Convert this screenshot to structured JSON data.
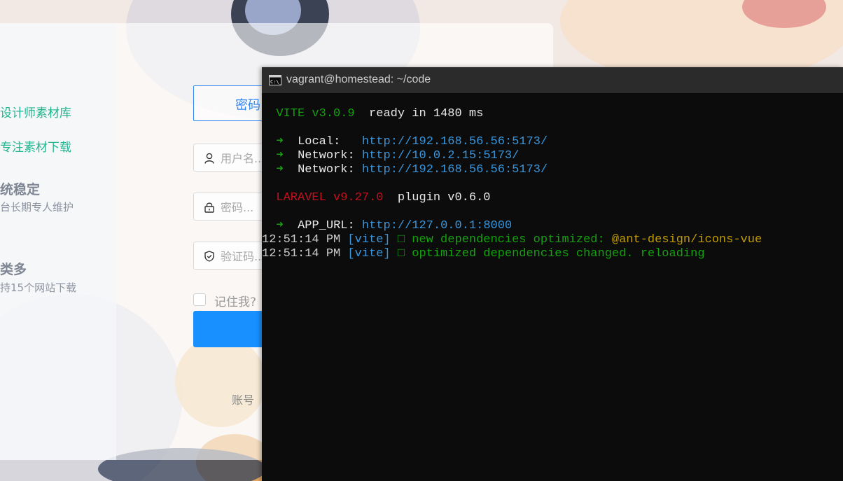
{
  "login": {
    "features": [
      {
        "text": "设计师素材库"
      },
      {
        "text": "专注素材下载"
      },
      {
        "title": "统稳定",
        "subtitle": "台长期专人维护"
      },
      {
        "title": "类多",
        "subtitle": "持15个网站下载"
      }
    ],
    "tab_label": "密码",
    "username_placeholder": "用户名...",
    "password_placeholder": "密码...",
    "captcha_placeholder": "验证码...",
    "remember_label": "记住我?",
    "account_link": "账号"
  },
  "terminal": {
    "window_title": "vagrant@homestead: ~/code",
    "vite_name": "VITE",
    "vite_version": "v3.0.9",
    "vite_ready": "ready in",
    "vite_ms": "1480",
    "vite_ms_unit": "ms",
    "local_label": "Local:",
    "local_url": "http://192.168.56.56:5173/",
    "network_label": "Network:",
    "network_url_1": "http://10.0.2.15:5173/",
    "network_url_2": "http://192.168.56.56:5173/",
    "laravel_name": "LARAVEL",
    "laravel_version": "v9.27.0",
    "plugin_label": "plugin",
    "plugin_version": "v0.6.0",
    "app_url_label": "APP_URL:",
    "app_url": "http://127.0.0.1:8000",
    "log": [
      {
        "time": "12:51:14 PM",
        "tag": "[vite]",
        "box": "□",
        "message": "new dependencies optimized:",
        "highlight": "@ant-design/icons-vue"
      },
      {
        "time": "12:51:14 PM",
        "tag": "[vite]",
        "box": "□",
        "message": "optimized dependencies changed. reloading"
      }
    ]
  },
  "colors": {
    "accent_blue": "#1890ff",
    "feature_green": "#1fb58f",
    "terminal_bg": "#0c0c0c",
    "term_green": "#13a10e",
    "term_blue": "#3b78ff",
    "term_red": "#c50f1f",
    "term_yellow": "#c19c00"
  },
  "icons": [
    "user-icon",
    "lock-icon",
    "shield-check-icon",
    "cmd-icon"
  ]
}
